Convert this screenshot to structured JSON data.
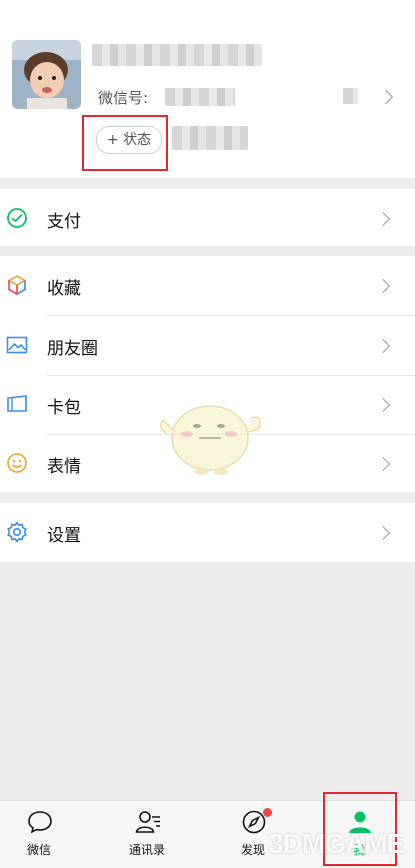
{
  "profile": {
    "wechat_id_label": "微信号:",
    "status_button": "+ 状态"
  },
  "menu": {
    "pay": {
      "label": "支付",
      "icon": "wallet-icon"
    },
    "favorites": {
      "label": "收藏",
      "icon": "cube-icon"
    },
    "moments": {
      "label": "朋友圈",
      "icon": "photo-icon"
    },
    "cards": {
      "label": "卡包",
      "icon": "card-icon"
    },
    "stickers": {
      "label": "表情",
      "icon": "smiley-icon"
    },
    "settings": {
      "label": "设置",
      "icon": "gear-icon"
    }
  },
  "tabbar": {
    "tabs": [
      {
        "label": "微信",
        "icon": "chat-bubble-icon",
        "active": false
      },
      {
        "label": "通讯录",
        "icon": "contacts-icon",
        "active": false
      },
      {
        "label": "发现",
        "icon": "compass-icon",
        "active": false,
        "badge": true
      },
      {
        "label": "我",
        "icon": "person-icon",
        "active": true
      }
    ]
  },
  "watermark": "3DMGAME",
  "colors": {
    "accent_green": "#07c160",
    "highlight_red": "#e0282e",
    "background": "#ededed"
  }
}
